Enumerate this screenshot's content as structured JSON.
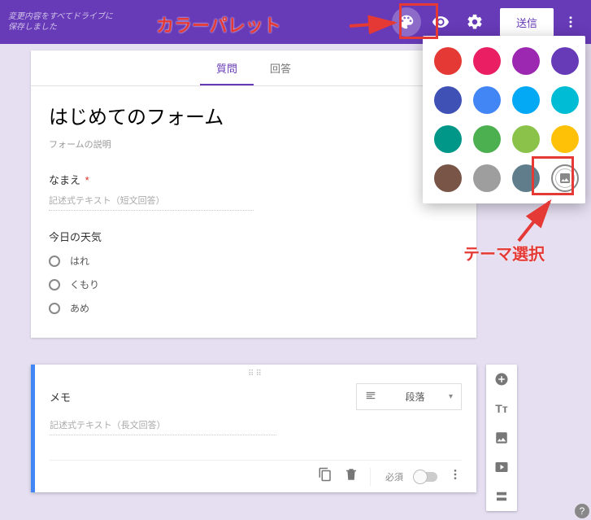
{
  "topbar": {
    "save_msg": "変更内容をすべてドライブに保存しました",
    "send_label": "送信"
  },
  "tabs": {
    "questions": "質問",
    "responses": "回答"
  },
  "form": {
    "title": "はじめてのフォーム",
    "description_placeholder": "フォームの説明",
    "q1_label": "なまえ",
    "q1_required_mark": "*",
    "q1_answer_placeholder": "記述式テキスト（短文回答）",
    "q2_label": "今日の天気",
    "q2_options": [
      "はれ",
      "くもり",
      "あめ"
    ]
  },
  "active_card": {
    "title": "メモ",
    "type_label": "段落",
    "answer_placeholder": "記述式テキスト（長文回答）",
    "required_label": "必須"
  },
  "palette_colors": [
    "#e53935",
    "#e91e63",
    "#9c27b0",
    "#673ab7",
    "#3f51b5",
    "#4285f4",
    "#03a9f4",
    "#00bcd4",
    "#009688",
    "#4caf50",
    "#8bc34a",
    "#ffc107",
    "#795548",
    "#9e9e9e",
    "#607d8b"
  ],
  "annotations": {
    "palette_label": "カラーパレット",
    "theme_label": "テーマ選択"
  },
  "help": "?"
}
